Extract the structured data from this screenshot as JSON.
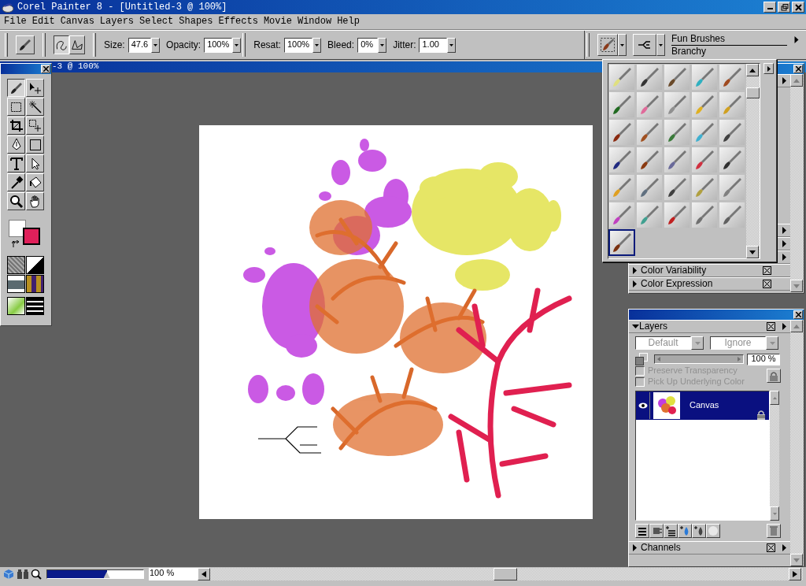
{
  "window": {
    "title": "Corel Painter 8 - [Untitled-3 @ 100%]"
  },
  "menu": [
    {
      "label": "File"
    },
    {
      "label": "Edit"
    },
    {
      "label": "Canvas"
    },
    {
      "label": "Layers"
    },
    {
      "label": "Select"
    },
    {
      "label": "Shapes"
    },
    {
      "label": "Effects"
    },
    {
      "label": "Movie"
    },
    {
      "label": "Window"
    },
    {
      "label": "Help"
    }
  ],
  "property_bar": {
    "stroke_types": [
      {
        "selected": true
      },
      {
        "selected": false
      }
    ],
    "fields": [
      {
        "label": "Size:",
        "value": "47.6"
      },
      {
        "label": "Opacity:",
        "value": "100%"
      },
      {
        "label": "Resat:",
        "value": "100%"
      },
      {
        "label": "Bleed:",
        "value": "0%"
      },
      {
        "label": "Jitter:",
        "value": "1.00"
      }
    ]
  },
  "brush_selector": {
    "category": "Fun Brushes",
    "variant": "Branchy"
  },
  "document": {
    "title": "-3 @ 100%",
    "zoom": "100 %",
    "zoom_slider": {
      "level": 0.62
    }
  },
  "toolbox": {
    "tools": [
      {
        "selected": true
      },
      {
        "selected": false
      },
      {
        "selected": false
      },
      {
        "selected": false
      },
      {
        "selected": false
      },
      {
        "selected": false
      },
      {
        "selected": false
      },
      {
        "selected": false
      },
      {
        "selected": false
      },
      {
        "selected": false
      },
      {
        "selected": false
      },
      {
        "selected": false
      },
      {
        "selected": false
      },
      {
        "selected": false
      }
    ]
  },
  "brush_library": {
    "categories": [
      {
        "selected": false
      },
      {
        "selected": false
      },
      {
        "selected": false
      },
      {
        "selected": false
      },
      {
        "selected": false
      },
      {
        "selected": false
      },
      {
        "selected": false
      },
      {
        "selected": false
      },
      {
        "selected": false
      },
      {
        "selected": false
      },
      {
        "selected": false
      },
      {
        "selected": false
      },
      {
        "selected": false
      },
      {
        "selected": false
      },
      {
        "selected": false
      },
      {
        "selected": false
      },
      {
        "selected": false
      },
      {
        "selected": false
      },
      {
        "selected": false
      },
      {
        "selected": false
      },
      {
        "selected": false
      },
      {
        "selected": false
      },
      {
        "selected": false
      },
      {
        "selected": false
      },
      {
        "selected": false
      },
      {
        "selected": false
      },
      {
        "selected": false
      },
      {
        "selected": false
      },
      {
        "selected": false
      },
      {
        "selected": false
      },
      {
        "selected": true
      }
    ]
  },
  "palettes": [
    {
      "title": "Color Variability",
      "expanded": false
    },
    {
      "title": "Color Expression",
      "expanded": false
    }
  ],
  "layers": {
    "title": "Layers",
    "expanded": true,
    "composite_method": "Default",
    "composite_depth": "Ignore",
    "opacity": "100 %",
    "controls_disabled": true,
    "options": [
      {
        "label": "Preserve Transparency",
        "checked": false
      },
      {
        "label": "Pick Up Underlying Color",
        "checked": false
      }
    ],
    "items": [
      {
        "name": "Canvas",
        "visible": true,
        "selected": true,
        "locked": true
      }
    ]
  },
  "channels": {
    "title": "Channels",
    "expanded": false
  }
}
